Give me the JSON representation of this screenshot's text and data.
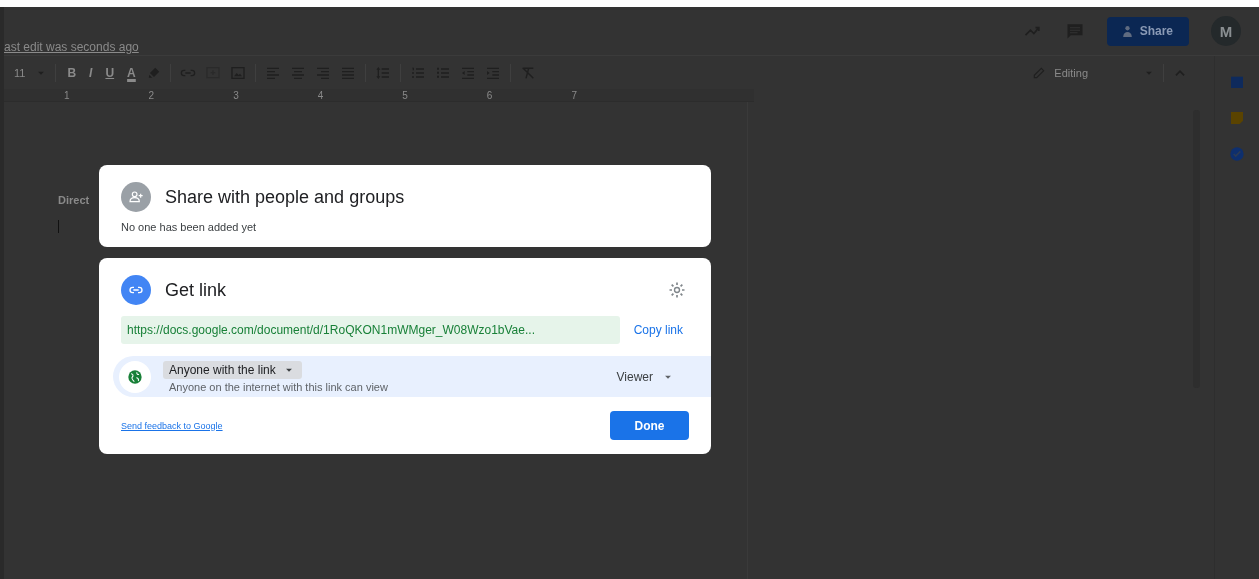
{
  "header": {
    "last_edit": "ast edit was seconds ago",
    "share_button": "Share",
    "avatar": "M"
  },
  "toolbar": {
    "font_size": "11",
    "format_buttons": [
      "B",
      "I",
      "U",
      "A"
    ],
    "mode": "Editing"
  },
  "ruler": {
    "numbers": [
      "1",
      "2",
      "3",
      "4",
      "5",
      "6",
      "7"
    ]
  },
  "document": {
    "visible_text": "Direct"
  },
  "dialog": {
    "share_card": {
      "title": "Share with people and groups",
      "subtitle": "No one has been added yet"
    },
    "link_card": {
      "title": "Get link",
      "url": "https://docs.google.com/document/d/1RoQKON1mWMger_W08Wzo1bVae...",
      "copy_link": "Copy link",
      "access": "Anyone with the link",
      "access_description": "Anyone on the internet with this link can view",
      "role": "Viewer",
      "feedback_link": "Send feedback to Google",
      "done_button": "Done"
    }
  }
}
